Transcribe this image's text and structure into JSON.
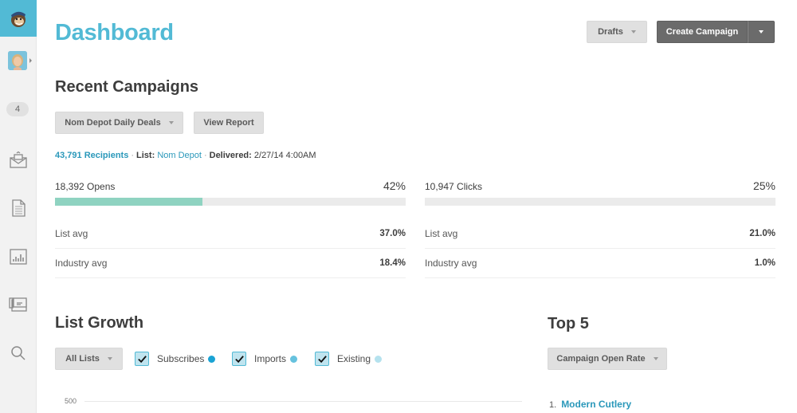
{
  "sidebar": {
    "logo": "mailchimp-logo",
    "notification_count": "4",
    "items": [
      {
        "name": "campaigns",
        "icon": "envelope-icon"
      },
      {
        "name": "templates",
        "icon": "document-icon"
      },
      {
        "name": "reports",
        "icon": "bar-chart-icon"
      },
      {
        "name": "lists",
        "icon": "cards-icon"
      },
      {
        "name": "search",
        "icon": "search-icon"
      }
    ]
  },
  "header": {
    "title": "Dashboard",
    "drafts_label": "Drafts",
    "create_campaign_label": "Create Campaign"
  },
  "recent_campaigns": {
    "title": "Recent Campaigns",
    "selected_campaign": "Nom Depot Daily Deals",
    "view_report_label": "View Report",
    "recipients": "43,791 Recipients",
    "list_label": "List:",
    "list_name": "Nom Depot",
    "delivered_label": "Delivered:",
    "delivered_value": "2/27/14 4:00AM",
    "opens": {
      "label": "18,392 Opens",
      "percent_text": "42%",
      "percent": 42,
      "bar_color": "#8fd3c1",
      "list_avg_label": "List avg",
      "list_avg_value": "37.0%",
      "industry_avg_label": "Industry avg",
      "industry_avg_value": "18.4%"
    },
    "clicks": {
      "label": "10,947 Clicks",
      "percent_text": "25%",
      "percent": 0,
      "bar_color": "#8fd3c1",
      "list_avg_label": "List avg",
      "list_avg_value": "21.0%",
      "industry_avg_label": "Industry avg",
      "industry_avg_value": "1.0%"
    }
  },
  "list_growth": {
    "title": "List Growth",
    "list_select": "All Lists",
    "legend": [
      {
        "label": "Subscribes",
        "checked": true,
        "color": "#1aa3d4"
      },
      {
        "label": "Imports",
        "checked": true,
        "color": "#66c2de"
      },
      {
        "label": "Existing",
        "checked": true,
        "color": "#b5e2ee"
      }
    ],
    "y_tick": "500"
  },
  "top5": {
    "title": "Top 5",
    "metric_select": "Campaign Open Rate",
    "items": [
      {
        "rank": "1.",
        "name": "Modern Cutlery"
      }
    ]
  },
  "colors": {
    "accent": "#52bad5",
    "link": "#2a98ba"
  }
}
